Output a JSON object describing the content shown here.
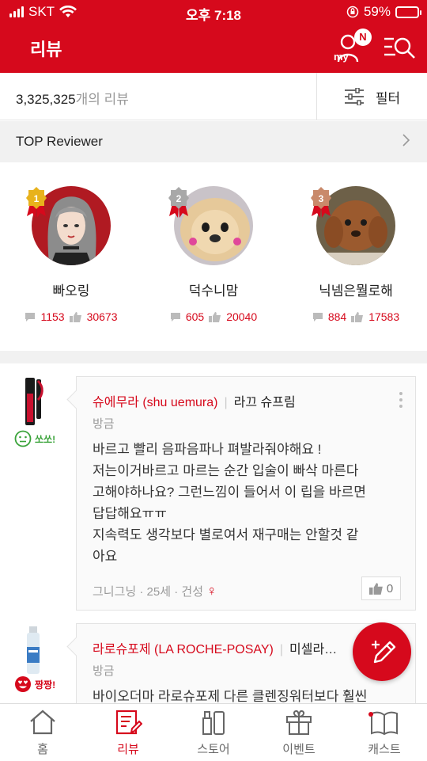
{
  "status_bar": {
    "carrier": "SKT",
    "time": "오후 7:18",
    "battery": "59%",
    "battery_level": 0.59
  },
  "header": {
    "title": "리뷰",
    "my_label": "my",
    "my_badge": "N"
  },
  "count_bar": {
    "count": "3,325,325",
    "suffix": "개의 리뷰",
    "filter_label": "필터"
  },
  "top_reviewer": {
    "title": "TOP Reviewer",
    "reviewers": [
      {
        "rank": "1",
        "name": "빠오링",
        "comments": "1153",
        "likes": "30673",
        "rank_color": "#e8b21c"
      },
      {
        "rank": "2",
        "name": "덕수니맘",
        "comments": "605",
        "likes": "20040",
        "rank_color": "#a8a8a8"
      },
      {
        "rank": "3",
        "name": "닉넴은뭘로해",
        "comments": "884",
        "likes": "17583",
        "rank_color": "#c98a6b"
      }
    ]
  },
  "reviews": [
    {
      "rating_label": "쏘쏘!",
      "rating_color": "#3aa33a",
      "brand": "슈에무라 (shu uemura)",
      "product": "라끄 슈프림",
      "time": "방금",
      "body_lines": [
        "바르고 빨리 음파음파나 펴발라줘야해요 !",
        "저는이거바르고 마르는 순간 입술이 빠삭 마른다",
        "고해야하나요? 그런느낌이 들어서 이 립을 바르면",
        "답답해요ㅠㅠ",
        "지속력도 생각보다 별로여서 재구매는 안할것 같",
        "아요"
      ],
      "author": "그니그닝",
      "age": "25세",
      "skin": "건성",
      "gender_symbol": "♀",
      "likes": "0"
    },
    {
      "rating_label": "짱짱!",
      "rating_color": "#d6091c",
      "brand": "라로슈포제 (LA ROCHE-POSAY)",
      "product": "미셀라…",
      "time": "방금",
      "body_lines": [
        "바이오더마 라로슈포제 다른 클렌징워터보다 훨씬"
      ]
    }
  ],
  "tabs": [
    {
      "label": "홈",
      "icon": "home-icon"
    },
    {
      "label": "리뷰",
      "icon": "review-icon"
    },
    {
      "label": "스토어",
      "icon": "store-icon"
    },
    {
      "label": "이벤트",
      "icon": "gift-icon"
    },
    {
      "label": "캐스트",
      "icon": "book-icon"
    }
  ],
  "colors": {
    "brand_red": "#d6091c",
    "muted_gray": "#999999",
    "section_bg": "#f1f1f1"
  }
}
